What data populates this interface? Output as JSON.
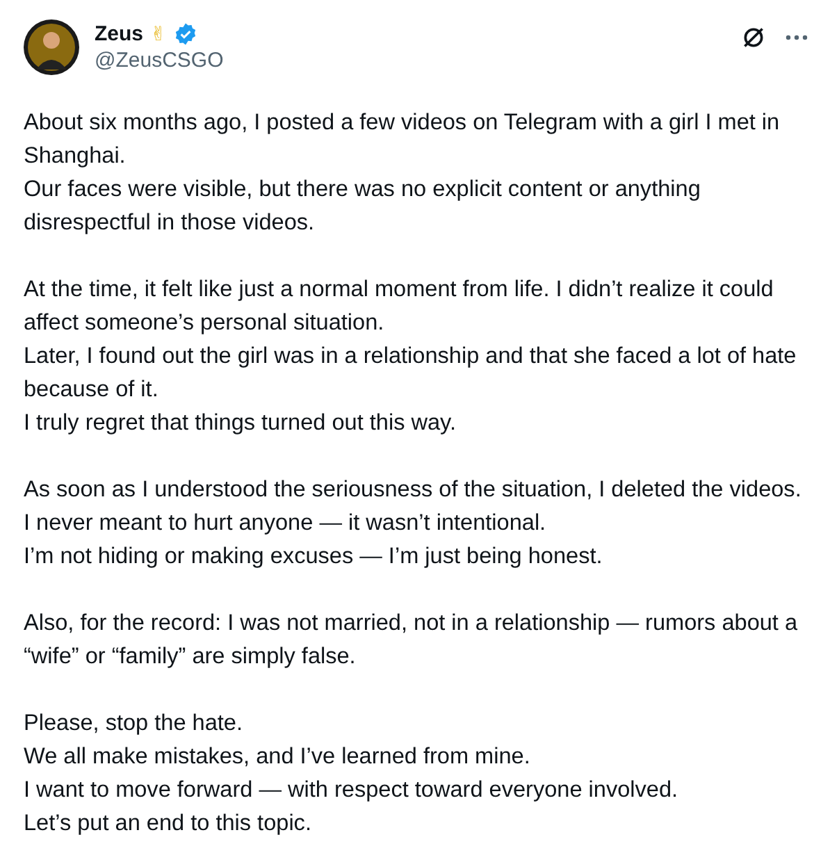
{
  "author": {
    "name": "Zeus",
    "emoji": "✌",
    "verified": true,
    "handle": "@ZeusCSGO"
  },
  "paragraphs": [
    [
      "About six months ago, I posted a few videos on Telegram with a girl I met in Shanghai.",
      "Our faces were visible, but there was no explicit content or anything disrespectful in those videos."
    ],
    [
      "At the time, it felt like just a normal moment from life. I didn’t realize it could affect someone’s personal situation.",
      "Later, I found out the girl was in a relationship and that she faced a lot of hate because of it.",
      "I truly regret that things turned out this way."
    ],
    [
      "As soon as I understood the seriousness of the situation, I deleted the videos.",
      "I never meant to hurt anyone — it wasn’t intentional.",
      "I’m not hiding or making excuses — I’m just being honest."
    ],
    [
      "Also, for the record: I was not married, not in a relationship — rumors about a “wife” or “family” are simply false."
    ],
    [
      "Please, stop the hate.",
      "We all make mistakes, and I’ve learned from mine.",
      "I want to move forward — with respect toward everyone involved.",
      "Let’s put an end to this topic."
    ]
  ]
}
